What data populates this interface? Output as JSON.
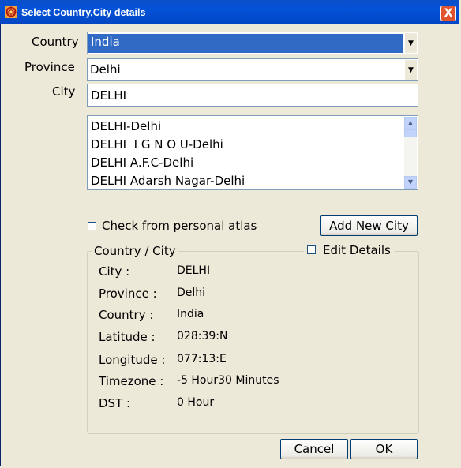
{
  "window": {
    "title": "Select Country,City details",
    "close_glyph": "X"
  },
  "labels": {
    "country": "Country",
    "province": "Province",
    "city": "City"
  },
  "country_select": {
    "value": "India"
  },
  "province_select": {
    "value": "Delhi"
  },
  "city_input": {
    "value": "DELHI"
  },
  "city_list": {
    "items": [
      "DELHI-Delhi",
      "DELHI  I G N O U-Delhi",
      "DELHI A.F.C-Delhi",
      "DELHI Adarsh Nagar-Delhi"
    ]
  },
  "personal_atlas": {
    "label": "Check from personal atlas",
    "checked": false
  },
  "add_city_button": {
    "label": "Add New City"
  },
  "details": {
    "group_title": "Country / City",
    "edit_label": "Edit Details",
    "edit_checked": false,
    "rows": [
      {
        "label": "City :",
        "value": "DELHI"
      },
      {
        "label": "Province :",
        "value": "Delhi"
      },
      {
        "label": "Country :",
        "value": "India"
      },
      {
        "label": "Latitude :",
        "value": "028:39:N"
      },
      {
        "label": "Longitude :",
        "value": "077:13:E"
      },
      {
        "label": "Timezone :",
        "value": "-5 Hour30 Minutes"
      },
      {
        "label": "DST :",
        "value": "0 Hour"
      }
    ]
  },
  "buttons": {
    "cancel": "Cancel",
    "ok": "OK"
  }
}
